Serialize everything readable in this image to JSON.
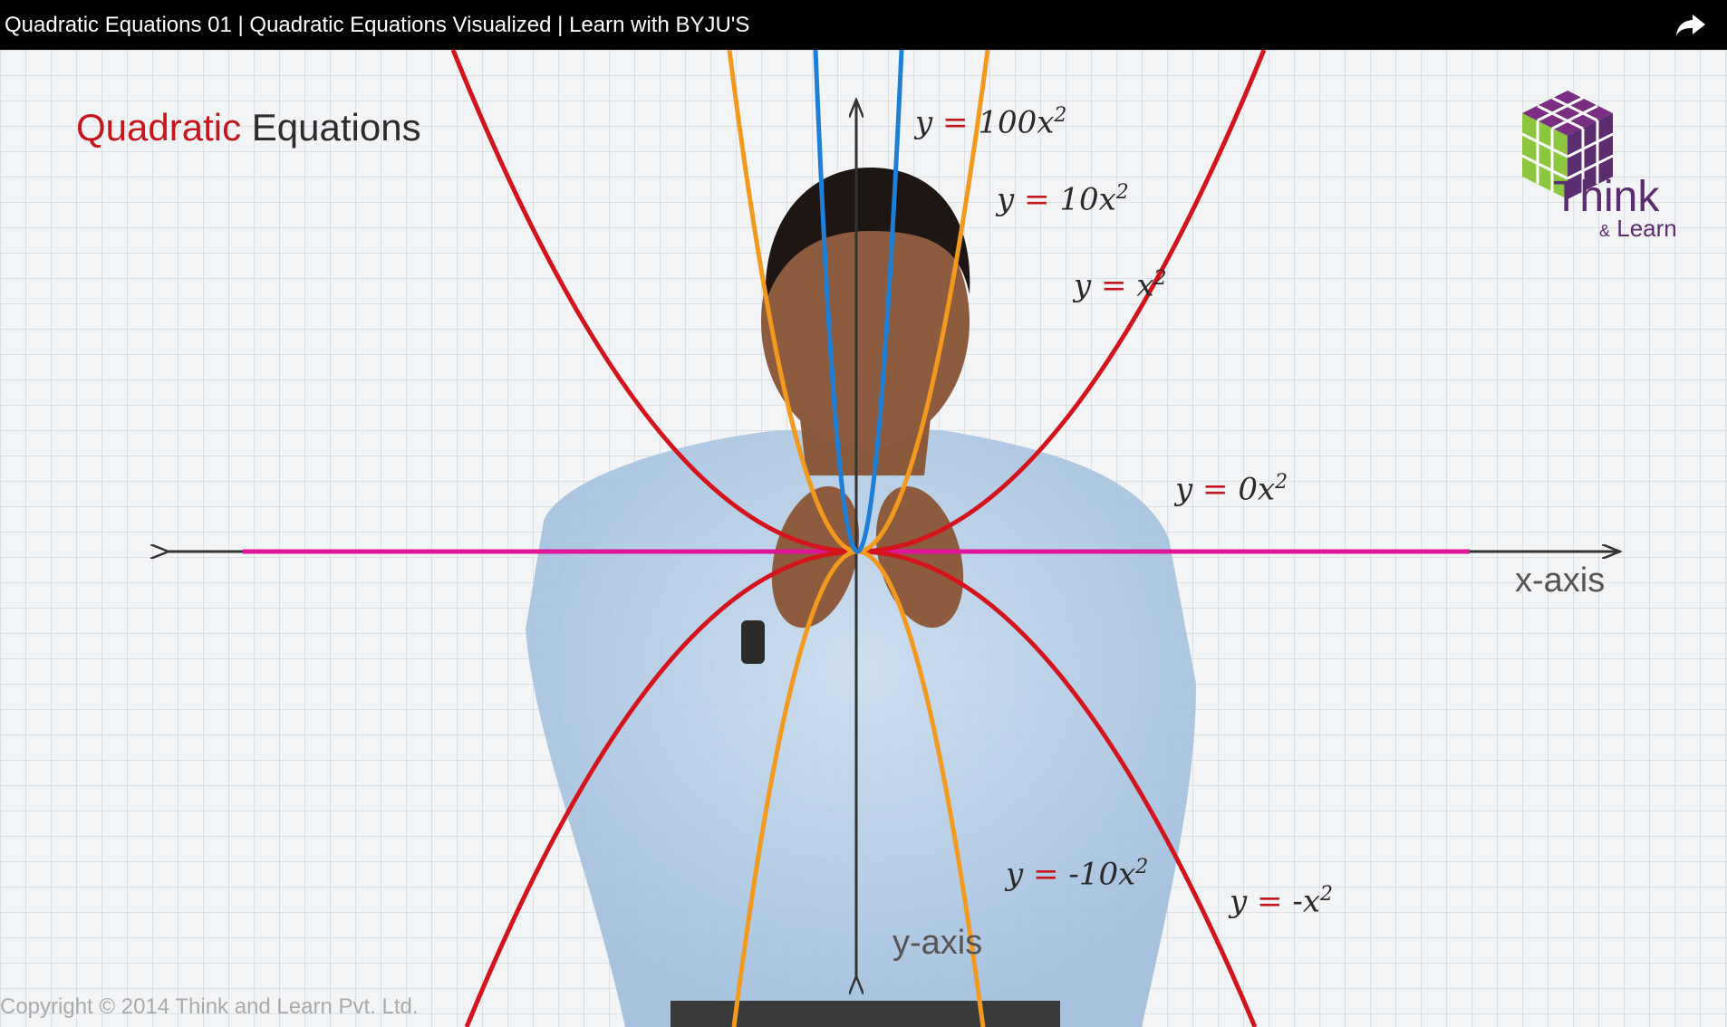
{
  "header": {
    "video_title": "Quadratic Equations 01 | Quadratic Equations Visualized | Learn with BYJU'S",
    "share_icon": "share-arrow-icon"
  },
  "overlay": {
    "title_part1": "Quadratic",
    "title_part2": "Equations",
    "equations": {
      "e100_lhs": "y",
      "e100_eq": "=",
      "e100_rhs": "100x",
      "e10_lhs": "y",
      "e10_eq": "=",
      "e10_rhs": "10x",
      "e1_lhs": "y",
      "e1_eq": "=",
      "e1_rhs": "x",
      "e0_lhs": "y",
      "e0_eq": "=",
      "e0_rhs": "0x",
      "en10_lhs": "y",
      "en10_eq": "=",
      "en10_rhs": "-10x",
      "en1_lhs": "y",
      "en1_eq": "=",
      "en1_rhs": "-x",
      "exponent": "2"
    },
    "x_axis_label": "x-axis",
    "y_axis_label": "y-axis"
  },
  "logo": {
    "think": "Think",
    "learn_amp": "&",
    "learn": "Learn"
  },
  "copyright": "Copyright © 2014 Think and Learn Pvt. Ltd.",
  "colors": {
    "red_curve": "#d3141c",
    "orange_curve": "#f39a1e",
    "blue_curve": "#1f7fd6",
    "magenta_line": "#e0169a",
    "axis": "#333333",
    "title_red": "#c4161c"
  }
}
